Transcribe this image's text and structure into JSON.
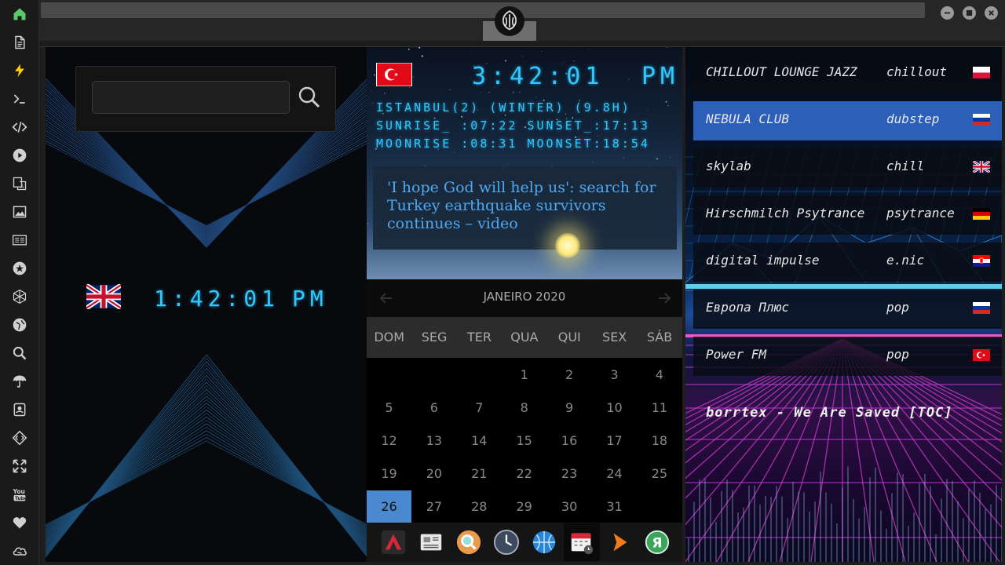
{
  "rail": [
    {
      "icon": "home-icon",
      "color": "#5cc86a"
    },
    {
      "icon": "document-icon"
    },
    {
      "icon": "lightning-icon",
      "color": "#ffcc00"
    },
    {
      "icon": "terminal-icon"
    },
    {
      "icon": "code-icon"
    },
    {
      "icon": "play-icon"
    },
    {
      "icon": "translate-icon"
    },
    {
      "icon": "image-icon"
    },
    {
      "icon": "news-icon"
    },
    {
      "icon": "star-badge-icon"
    },
    {
      "icon": "hexagon-icon"
    },
    {
      "icon": "globe-icon"
    },
    {
      "icon": "search-icon"
    },
    {
      "icon": "umbrella-icon"
    },
    {
      "icon": "contacts-icon"
    },
    {
      "icon": "diamond-code-icon"
    },
    {
      "icon": "expand-icon"
    },
    {
      "icon": "youtube-icon"
    },
    {
      "icon": "heart-icon"
    },
    {
      "icon": "cloud-icon"
    }
  ],
  "window": {
    "logo_icon": "rebel-alliance-icon"
  },
  "left": {
    "search_placeholder": "",
    "clock": {
      "time": "1:42:01",
      "ampm": "PM",
      "flag": "uk-flag-icon"
    }
  },
  "middle": {
    "clock": {
      "time": "3:42:01",
      "ampm": "PM",
      "flag": "turkey-flag-icon"
    },
    "info": [
      "ISTANBUL(2) (WINTER) (9.8H)",
      "SUNRISE_ :07:22 SUNSET_:17:13",
      "MOONRISE :08:31 MOONSET:18:54"
    ],
    "news": "'I hope God will help us': search for Turkey earthquake survivors continues – video",
    "calendar": {
      "title": "JANEIRO 2020",
      "weekdays": [
        "DOM",
        "SEG",
        "TER",
        "QUA",
        "QUI",
        "SEX",
        "SÁB"
      ],
      "first_weekday": 3,
      "days_in_month": 31,
      "selected": 26
    },
    "dock": [
      "app-triangle-icon",
      "news-app-icon",
      "search-app-icon",
      "clock-app-icon",
      "browser-globe-icon",
      "calendar-app-icon",
      "media-play-icon",
      "yandex-icon"
    ]
  },
  "radio": {
    "stations": [
      {
        "name": "CHILLOUT LOUNGE JAZZ",
        "genre": "chillout",
        "flag": "poland"
      },
      {
        "name": "NEBULA CLUB",
        "genre": "dubstep",
        "flag": "russia",
        "active": true
      },
      {
        "name": "skylab",
        "genre": "chill",
        "flag": "uk"
      },
      {
        "name": "Hirschmilch Psytrance",
        "genre": "psytrance",
        "flag": "germany"
      },
      {
        "name": "digital impulse",
        "genre": "e.nic",
        "flag": "croatia"
      },
      {
        "name": "Европа Плюс",
        "genre": "pop",
        "flag": "russia"
      },
      {
        "name": "Power FM",
        "genre": "pop",
        "flag": "turkey"
      }
    ],
    "now_playing": "borrtex - We Are Saved [TOC]"
  },
  "colors": {
    "accent": "#2fc8ff",
    "selected_day": "#4a88d0",
    "active_station": "#2b5fb8"
  }
}
